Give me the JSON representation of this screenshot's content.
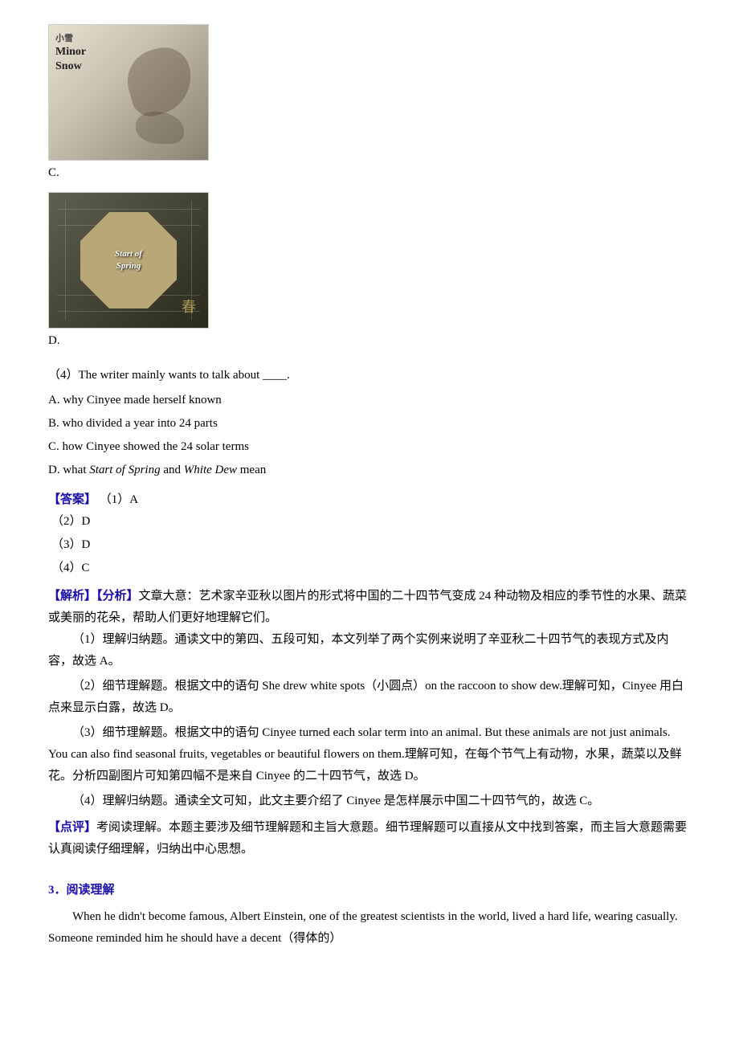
{
  "images": {
    "c_label": "C.",
    "d_label": "D.",
    "minor_snow_line1": "Minor",
    "minor_snow_line2": "Snow",
    "minor_snow_chinese": "小雪",
    "start_of_spring_line1": "Start of",
    "start_of_spring_line2": "Spring"
  },
  "question4": {
    "text": "（4）The writer mainly wants to talk about ____.",
    "options": [
      "A. why Cinyee made herself known",
      "B. who divided a year into 24 parts",
      "C. how Cinyee showed the 24 solar terms",
      "D. what Start of Spring and White Dew mean"
    ],
    "option_d_italic_start": "Start of Spring",
    "option_d_italic_end": "White Dew"
  },
  "answers": {
    "label": "【答案】",
    "lines": [
      "（1）A",
      "（2）D",
      "（3）D",
      "（4）C"
    ]
  },
  "analysis": {
    "label": "【解析】",
    "sublabel": "【分析】",
    "summary": "文章大意：艺术家辛亚秋以图片的形式将中国的二十四节气变成 24 种动物及相应的季节性的水果、蔬菜或美丽的花朵，帮助人们更好地理解它们。",
    "paragraphs": [
      "（1）理解归纳题。通读文中的第四、五段可知，本文列举了两个实例来说明了辛亚秋二十四节气的表现方式及内容，故选 A。",
      "（2）细节理解题。根据文中的语句 She drew white spots（小圆点）on the raccoon to show dew.理解可知，Cinyee 用白点来显示白露，故选 D。",
      "（3）细节理解题。根据文中的语句 Cinyee turned each solar term into an animal. But these animals are not just animals. You can also find seasonal fruits, vegetables or beautiful flowers on them.理解可知，在每个节气上有动物，水果，蔬菜以及鲜花。分析四副图片可知第四幅不是来自 Cinyee 的二十四节气，故选 D。",
      "（4）理解归纳题。通读全文可知，此文主要介绍了 Cinyee 是怎样展示中国二十四节气的，故选 C。"
    ]
  },
  "comment": {
    "label": "【点评】",
    "text": "考阅读理解。本题主要涉及细节理解题和主旨大意题。细节理解题可以直接从文中找到答案，而主旨大意题需要认真阅读仔细理解，归纳出中心思想。"
  },
  "section3": {
    "number": "3．",
    "title": "阅读理解",
    "paragraph": "When he didn't become famous, Albert Einstein, one of the greatest scientists in the world, lived a hard life, wearing casually. Someone reminded him he should have a decent（得体的）"
  }
}
